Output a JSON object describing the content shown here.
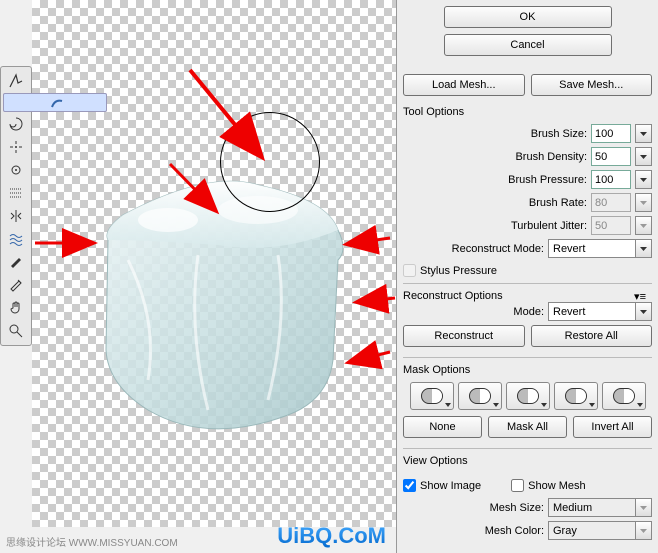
{
  "dialog": {
    "ok": "OK",
    "cancel": "Cancel",
    "load_mesh": "Load Mesh...",
    "save_mesh": "Save Mesh..."
  },
  "tool_options": {
    "title": "Tool Options",
    "brush_size": {
      "label": "Brush Size:",
      "value": "100"
    },
    "brush_density": {
      "label": "Brush Density:",
      "value": "50"
    },
    "brush_pressure": {
      "label": "Brush Pressure:",
      "value": "100"
    },
    "brush_rate": {
      "label": "Brush Rate:",
      "value": "80"
    },
    "turbulent_jitter": {
      "label": "Turbulent Jitter:",
      "value": "50"
    },
    "reconstruct_mode": {
      "label": "Reconstruct Mode:",
      "value": "Revert"
    },
    "stylus_pressure": "Stylus Pressure"
  },
  "reconstruct": {
    "title": "Reconstruct Options",
    "mode": {
      "label": "Mode:",
      "value": "Revert"
    },
    "reconstruct_btn": "Reconstruct",
    "restore_btn": "Restore All"
  },
  "mask": {
    "title": "Mask Options",
    "none": "None",
    "mask_all": "Mask All",
    "invert_all": "Invert All"
  },
  "view": {
    "title": "View Options",
    "show_image": "Show Image",
    "show_mesh": "Show Mesh",
    "mesh_size": {
      "label": "Mesh Size:",
      "value": "Medium"
    },
    "mesh_color": {
      "label": "Mesh Color:",
      "value": "Gray"
    }
  },
  "watermark": {
    "left": "思缘设计论坛  WWW.MISSYUAN.COM",
    "right": "UiBQ.CoM"
  },
  "tools": [
    "forward-warp",
    "reconstruct",
    "twirl",
    "pucker",
    "bloat",
    "push-left",
    "mirror",
    "turbulence",
    "freeze",
    "thaw",
    "hand",
    "zoom"
  ]
}
